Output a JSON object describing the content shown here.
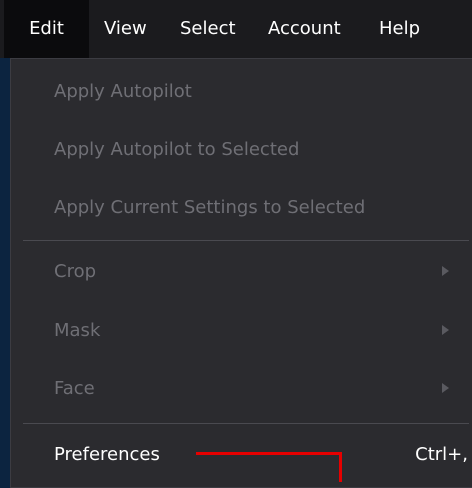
{
  "menubar": {
    "items": [
      {
        "label": "Edit"
      },
      {
        "label": "View"
      },
      {
        "label": "Select"
      },
      {
        "label": "Account"
      },
      {
        "label": "Help"
      }
    ]
  },
  "dropdown": {
    "items": [
      {
        "label": "Apply Autopilot",
        "enabled": false
      },
      {
        "label": "Apply Autopilot to Selected",
        "enabled": false
      },
      {
        "label": "Apply Current Settings to Selected",
        "enabled": false
      },
      {
        "label": "Crop",
        "enabled": false,
        "submenu": true
      },
      {
        "label": "Mask",
        "enabled": false,
        "submenu": true
      },
      {
        "label": "Face",
        "enabled": false,
        "submenu": true
      },
      {
        "label": "Preferences",
        "enabled": true,
        "shortcut": "Ctrl+,"
      }
    ]
  },
  "annotation": {
    "color": "#e60000"
  }
}
